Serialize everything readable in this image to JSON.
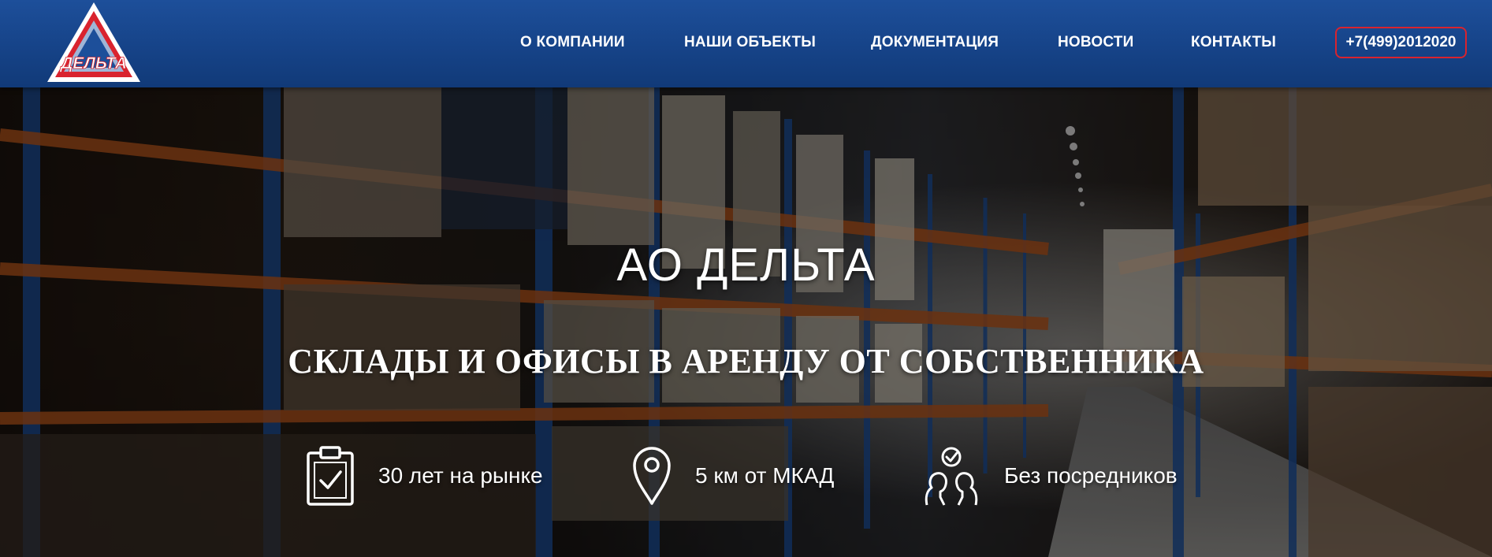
{
  "header": {
    "logo_text": "ДЕЛЬТА",
    "nav": [
      {
        "label": "О КОМПАНИИ"
      },
      {
        "label": "НАШИ ОБЪЕКТЫ"
      },
      {
        "label": "ДОКУМЕНТАЦИЯ"
      },
      {
        "label": "НОВОСТИ"
      },
      {
        "label": "КОНТАКТЫ"
      }
    ],
    "phone": "+7(499)2012020"
  },
  "hero": {
    "title": "АО ДЕЛЬТА",
    "subtitle": "СКЛАДЫ И ОФИСЫ В АРЕНДУ ОТ СОБСТВЕННИКА",
    "features": [
      {
        "icon": "clipboard-check-icon",
        "label": "30 лет на рынке"
      },
      {
        "icon": "map-pin-icon",
        "label": "5 км от МКАД"
      },
      {
        "icon": "handshake-people-icon",
        "label": "Без посредников"
      }
    ]
  },
  "colors": {
    "header_bg": "#164388",
    "phone_border": "#d9232e",
    "logo_red": "#d9232e",
    "logo_blue": "#1d4f9a"
  }
}
